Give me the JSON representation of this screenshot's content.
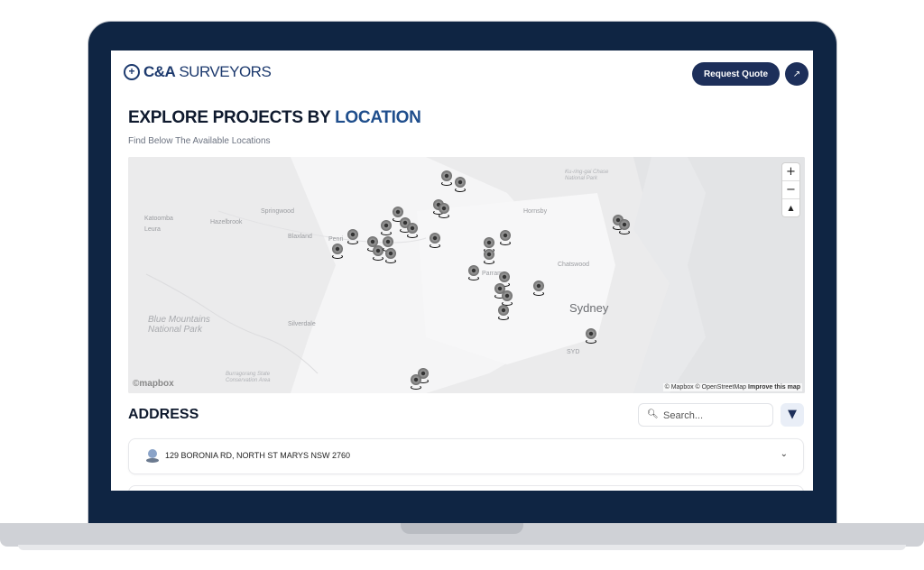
{
  "brand": {
    "name_bold": "C&A",
    "name_light": "SURVEYORS",
    "logo_icon": "plus-circle-icon"
  },
  "nav": {
    "quote_label": "Request Quote",
    "arrow_glyph": "↗"
  },
  "hero": {
    "title_prefix": "EXPLORE PROJECTS BY ",
    "title_highlight": "LOCATION",
    "subtitle": "Find Below The Available Locations"
  },
  "map": {
    "labels": {
      "katoomba": "Katoomba",
      "leura": "Leura",
      "hazelbrook": "Hazelbrook",
      "springwood": "Springwood",
      "blaxland": "Blaxland",
      "penrith": "Penri",
      "hornsby": "Hornsby",
      "chatswood": "Chatswood",
      "sydney": "Sydney",
      "silverdale": "Silverdale",
      "syd": "SYD",
      "parramatta": "Parrama",
      "blue_mountains": "Blue Mountains National Park",
      "kuringgai": "Ku-ring-gai Chase National Park",
      "burragorang": "Burragorang State Conservation Area"
    },
    "zoom": {
      "in": "+",
      "out": "−",
      "north": "▲"
    },
    "attribution": "© Mapbox © OpenStreetMap",
    "improve": "Improve this map",
    "provider": "©mapbox"
  },
  "addresses": {
    "title": "ADDRESS",
    "search_placeholder": "Search...",
    "filter_icon": "filter-icon",
    "items": [
      {
        "text": "129 BORONIA RD, NORTH ST MARYS NSW 2760"
      }
    ]
  },
  "colors": {
    "primary": "#1d2f5a",
    "accent": "#1f4e8c",
    "laptop": "#0f2543"
  }
}
